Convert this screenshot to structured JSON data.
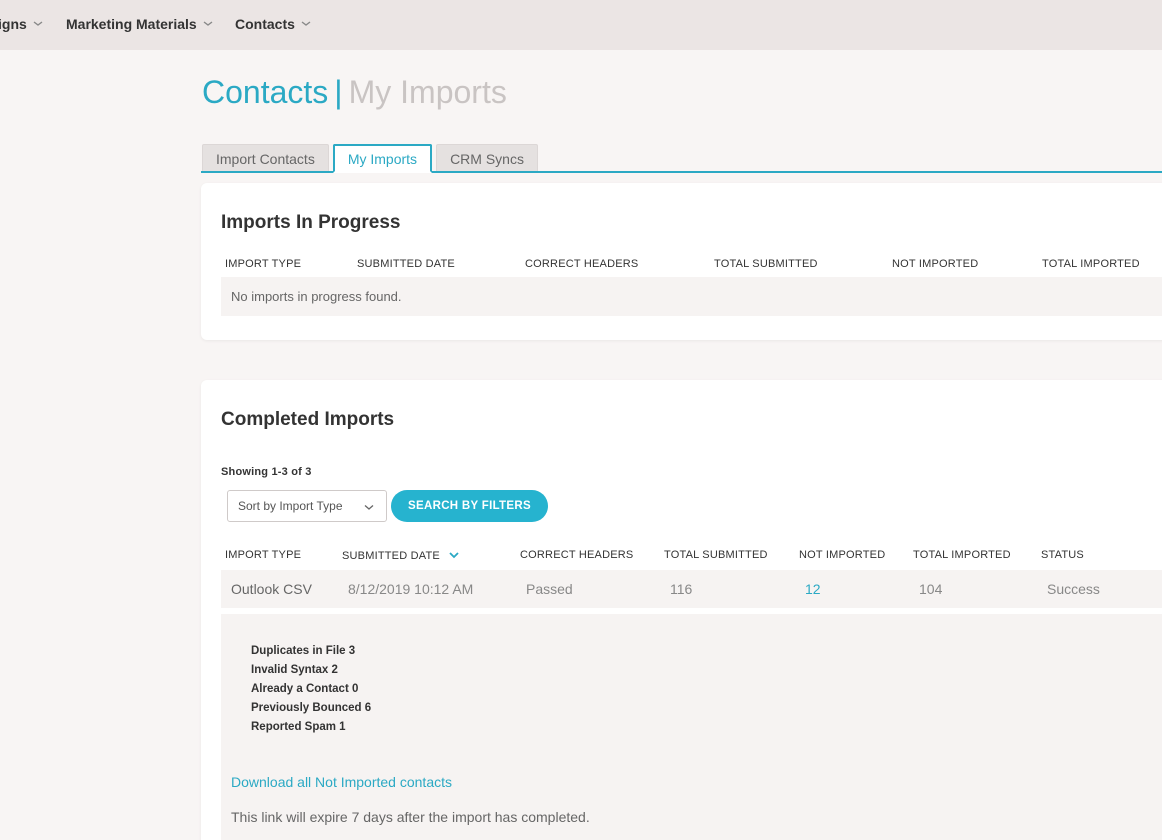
{
  "nav": {
    "items": [
      {
        "label": "igns"
      },
      {
        "label": "Marketing Materials"
      },
      {
        "label": "Contacts"
      }
    ]
  },
  "page": {
    "title_primary": "Contacts",
    "title_separator": "|",
    "title_secondary": "My Imports"
  },
  "tabs": [
    {
      "label": "Import Contacts",
      "active": false
    },
    {
      "label": "My Imports",
      "active": true
    },
    {
      "label": "CRM Syncs",
      "active": false
    }
  ],
  "in_progress": {
    "title": "Imports In Progress",
    "columns": [
      "IMPORT TYPE",
      "SUBMITTED DATE",
      "CORRECT HEADERS",
      "TOTAL SUBMITTED",
      "NOT IMPORTED",
      "TOTAL IMPORTED"
    ],
    "empty_message": "No imports in progress found."
  },
  "completed": {
    "title": "Completed Imports",
    "showing": "Showing 1-3 of 3",
    "sort_select_value": "Sort by Import Type",
    "search_button": "SEARCH BY FILTERS",
    "columns": [
      "IMPORT TYPE",
      "SUBMITTED DATE",
      "CORRECT HEADERS",
      "TOTAL SUBMITTED",
      "NOT IMPORTED",
      "TOTAL IMPORTED",
      "STATUS"
    ],
    "rows": [
      {
        "import_type": "Outlook CSV",
        "submitted_date": "8/12/2019 10:12 AM",
        "correct_headers": "Passed",
        "total_submitted": "116",
        "not_imported": "12",
        "total_imported": "104",
        "status": "Success"
      }
    ],
    "details": [
      "Duplicates in File 3",
      "Invalid Syntax 2",
      "Already a Contact 0",
      "Previously Bounced 6",
      "Reported Spam 1"
    ],
    "download_link": "Download all Not Imported contacts",
    "expire_note": "This link will expire 7 days after the import has completed."
  },
  "colors": {
    "accent": "#2ba9c4",
    "button": "#26b3cf",
    "nav_bg": "#ebe5e4",
    "page_bg": "#f8f5f4"
  }
}
